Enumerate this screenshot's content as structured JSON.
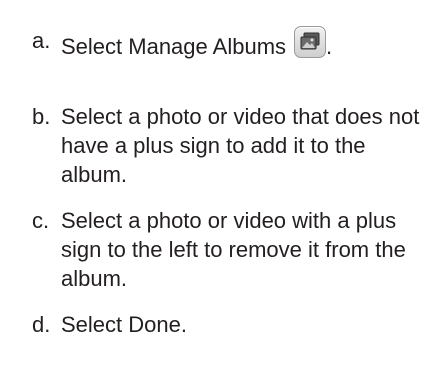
{
  "steps": [
    {
      "letter": "a.",
      "text_before_icon": "Select Manage Albums",
      "icon": "manage-albums-icon",
      "text_after_icon": "."
    },
    {
      "letter": "b.",
      "text": "Select a photo or video that does not have a plus sign to add it to the album."
    },
    {
      "letter": "c.",
      "text": "Select a photo or video with a plus sign to the left to remove it from the album."
    },
    {
      "letter": "d.",
      "text": "Select Done."
    }
  ]
}
